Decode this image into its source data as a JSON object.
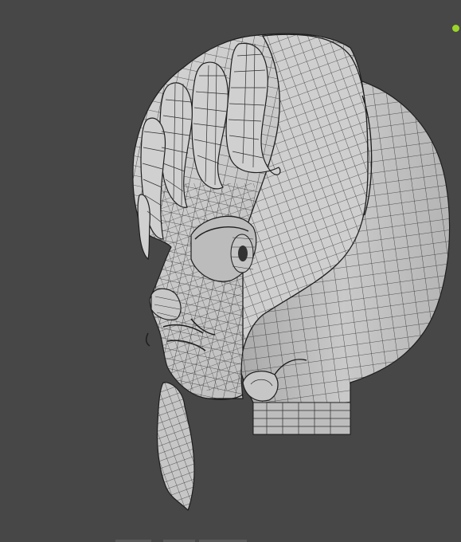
{
  "viewport": {
    "background": "#474747",
    "mesh_fill": "#c8c8c8",
    "mesh_shadow": "#8e8e8e",
    "wire_color": "#2e2e2e",
    "status_indicator_color": "#9cd52a"
  },
  "icons": [
    "status-dot-icon"
  ]
}
